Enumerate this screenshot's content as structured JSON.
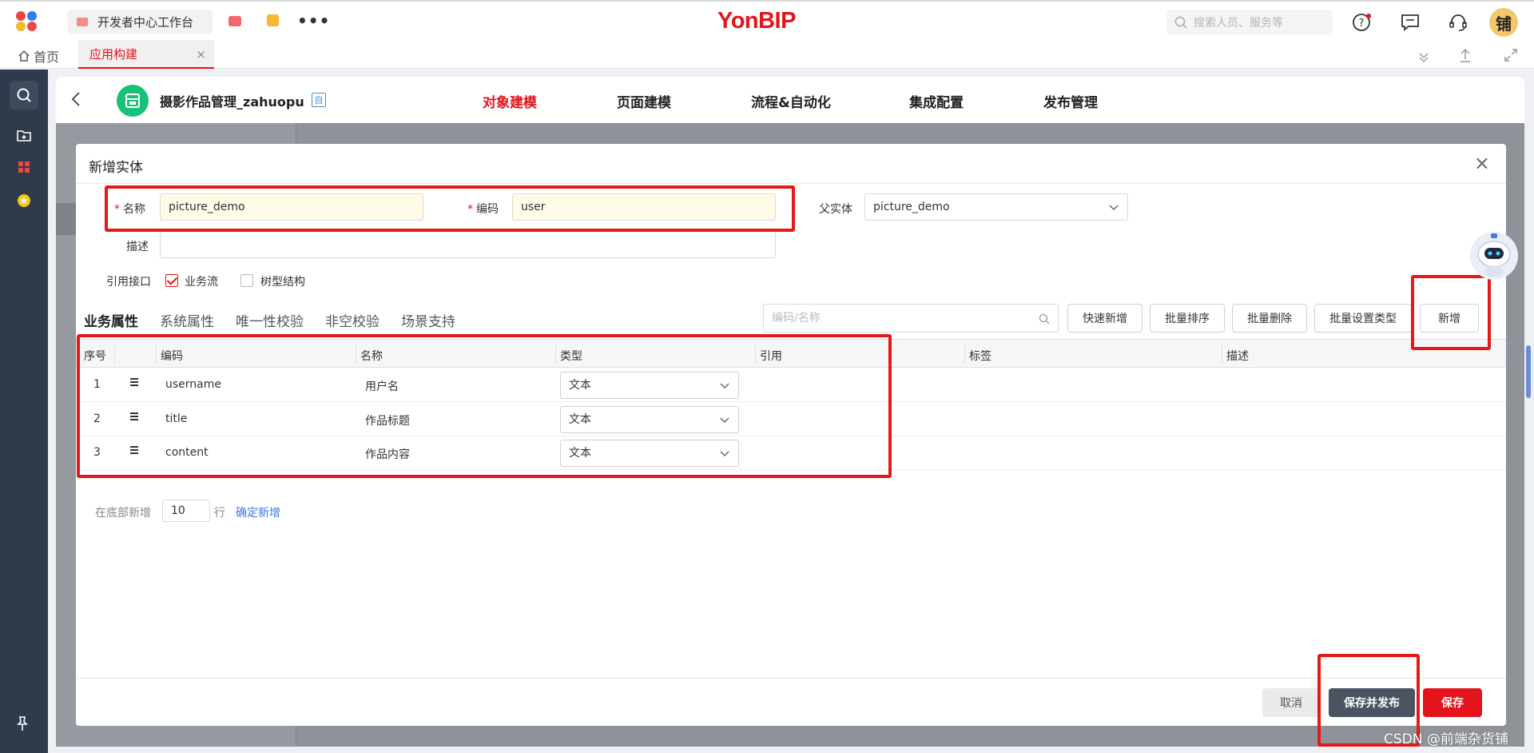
{
  "topbar": {
    "workbench": "开发者中心工作台",
    "more": "•••",
    "brand": "YonBIP",
    "search_placeholder": "搜索人员、服务等",
    "avatar": "铺"
  },
  "tabs": {
    "home": "首页",
    "active": "应用构建",
    "close": "×"
  },
  "app": {
    "back": "<",
    "title": "摄影作品管理_zahuopu",
    "badge": "自",
    "nav": [
      "对象建模",
      "页面建模",
      "流程&自动化",
      "集成配置",
      "发布管理"
    ]
  },
  "modal": {
    "title": "新增实体",
    "close": "×",
    "name_label": "名称",
    "name_value": "picture_demo",
    "code_label": "编码",
    "code_value": "user",
    "parent_label": "父实体",
    "parent_value": "picture_demo",
    "desc_label": "描述",
    "desc_value": "",
    "interface_label": "引用接口",
    "cb_business": "业务流",
    "cb_tree": "树型结构",
    "subtabs": [
      "业务属性",
      "系统属性",
      "唯一性校验",
      "非空校验",
      "场景支持"
    ],
    "search_placeholder": "编码/名称",
    "buttons": [
      "快速新增",
      "批量排序",
      "批量删除",
      "批量设置类型",
      "新增"
    ],
    "columns": [
      "序号",
      "编码",
      "名称",
      "类型",
      "引用",
      "标签",
      "描述"
    ],
    "rows": [
      {
        "no": "1",
        "code": "username",
        "name": "用户名",
        "type": "文本"
      },
      {
        "no": "2",
        "code": "title",
        "name": "作品标题",
        "type": "文本"
      },
      {
        "no": "3",
        "code": "content",
        "name": "作品内容",
        "type": "文本"
      }
    ],
    "add_prefix": "在底部新增",
    "add_count": "10",
    "add_suffix": "行",
    "add_confirm": "确定新增",
    "cancel": "取消",
    "save_publish": "保存并发布",
    "save": "保存"
  },
  "watermark": "CSDN @前端杂货铺",
  "colors": {
    "brand_red": "#e3141c",
    "annotation_red": "#e31a1a",
    "rail_bg": "#2f3a4b",
    "link_blue": "#3a7be0",
    "dark_button": "#4a5361"
  }
}
